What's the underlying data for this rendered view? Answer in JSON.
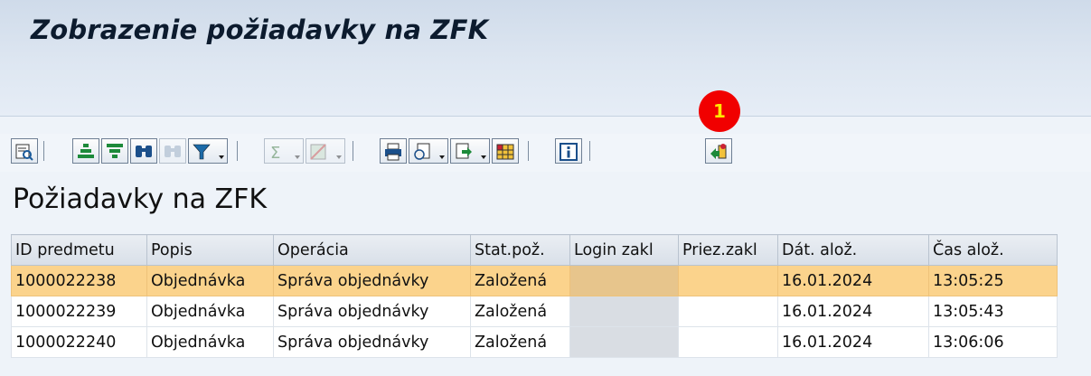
{
  "window": {
    "title": "Zobrazenie požiadavky na ZFK"
  },
  "badge": {
    "label": "1",
    "color": "#f10000"
  },
  "toolbar": {
    "buttons": [
      "details-icon",
      "sort-ascending-icon",
      "sort-descending-icon",
      "find-icon",
      "find-next-icon",
      "filter-icon",
      "sum-icon",
      "subtotals-icon",
      "print-icon",
      "layout-icon",
      "export-icon",
      "grid-icon",
      "info-icon",
      "transfer-icon"
    ]
  },
  "list": {
    "title": "Požiadavky na ZFK",
    "columns": [
      "ID predmetu",
      "Popis",
      "Operácia",
      "Stat.pož.",
      "Login zakl",
      "Priez.zakl",
      "Dát. alož.",
      "Čas alož."
    ],
    "rows": [
      {
        "id": "1000022238",
        "popis": "Objednávka",
        "operacia": "Správa objednávky",
        "stat": "Založená",
        "login": "",
        "priez": "",
        "datum": "16.01.2024",
        "cas": "13:05:25",
        "selected": true
      },
      {
        "id": "1000022239",
        "popis": "Objednávka",
        "operacia": "Správa objednávky",
        "stat": "Založená",
        "login": "",
        "priez": "",
        "datum": "16.01.2024",
        "cas": "13:05:43",
        "selected": false
      },
      {
        "id": "1000022240",
        "popis": "Objednávka",
        "operacia": "Správa objednávky",
        "stat": "Založená",
        "login": "",
        "priez": "",
        "datum": "16.01.2024",
        "cas": "13:06:06",
        "selected": false
      }
    ]
  },
  "colors": {
    "selected_row": "#fbd38c",
    "header_bg": "#dde6f1"
  }
}
